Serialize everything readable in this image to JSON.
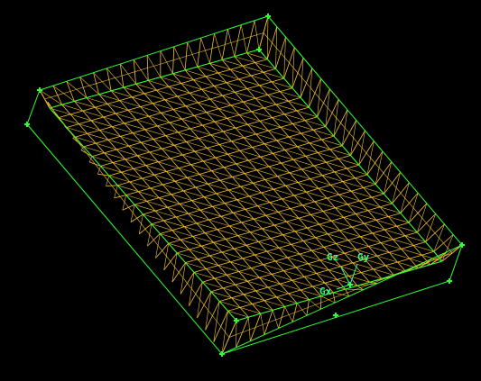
{
  "viewport": {
    "background": "#000000",
    "mesh_color": "#f0c030",
    "edge_color": "#30ff30",
    "node_marker": "plus-marker",
    "mesh_divisions": {
      "length": 22,
      "width": 17
    }
  },
  "triad": {
    "x_label": "Gx",
    "y_label": "Gy",
    "z_label": "Gz",
    "color": "#30ff90"
  }
}
